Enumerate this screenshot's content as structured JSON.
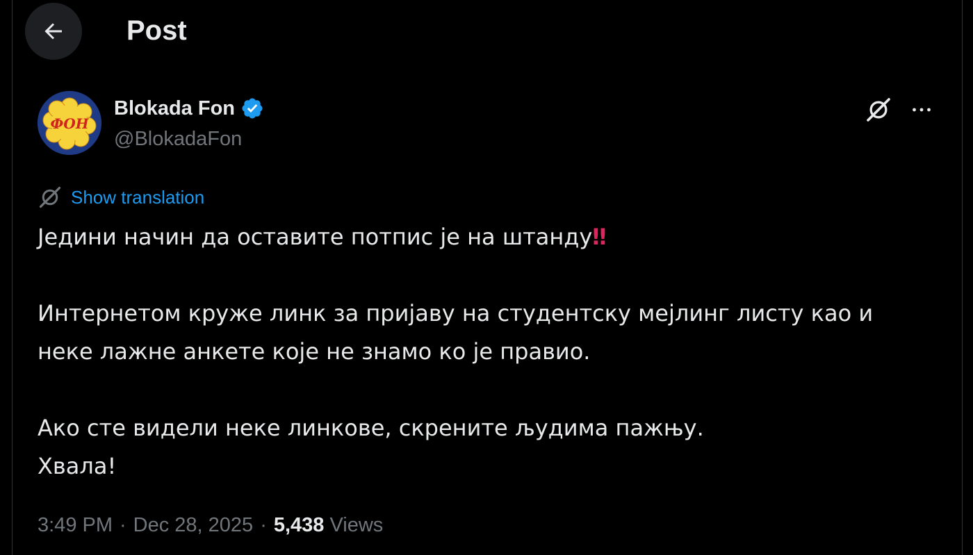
{
  "header": {
    "title": "Post"
  },
  "author": {
    "display_name": "Blokada Fon",
    "handle": "@BlokadaFon",
    "avatar_text": "ФОН",
    "verified": true,
    "verified_color": "#1d9bf0"
  },
  "translation": {
    "label": "Show translation"
  },
  "tweet": {
    "line1": "Једини начин да оставите потпис је на штанду",
    "line1_emoji": "‼",
    "line2": "Интернетом круже линк за пријаву на студентску мејлинг листу као и",
    "line3": "неке лажне анкете које не знамо ко је правио.",
    "line4": "Ако сте видели неке линкове, скрените људима пажњу.",
    "line5": "Хвала!"
  },
  "meta": {
    "time": "3:49 PM",
    "date": "Dec 28, 2025",
    "separator": "·",
    "views_count": "5,438",
    "views_label": "Views"
  },
  "icons": {
    "back": "arrow-left-icon",
    "grok": "grok-icon",
    "more": "more-horizontal-icon",
    "translate": "translate-icon",
    "verified": "verified-badge-icon"
  },
  "colors": {
    "background": "#000000",
    "text_primary": "#e7e9ea",
    "text_secondary": "#71767b",
    "link": "#1d9bf0",
    "emoji_red": "#e0245e"
  }
}
